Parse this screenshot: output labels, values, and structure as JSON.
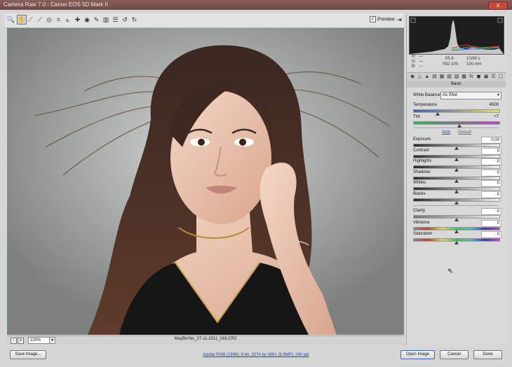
{
  "window": {
    "title": "Camera Raw 7.0  -  Canon EOS 5D Mark II",
    "close_glyph": "x"
  },
  "toolbar": {
    "tools": [
      {
        "name": "zoom-tool-icon",
        "glyph": "🔍"
      },
      {
        "name": "hand-tool-icon",
        "glyph": "✋"
      },
      {
        "name": "white-balance-tool-icon",
        "glyph": "⟋"
      },
      {
        "name": "color-sampler-tool-icon",
        "glyph": "⟋"
      },
      {
        "name": "targeted-adjustment-tool-icon",
        "glyph": "◎"
      },
      {
        "name": "crop-tool-icon",
        "glyph": "⌗"
      },
      {
        "name": "straighten-tool-icon",
        "glyph": "⟀"
      },
      {
        "name": "spot-removal-tool-icon",
        "glyph": "✚"
      },
      {
        "name": "red-eye-tool-icon",
        "glyph": "◉"
      },
      {
        "name": "adjustment-brush-icon",
        "glyph": "✎"
      },
      {
        "name": "graduated-filter-icon",
        "glyph": "▥"
      },
      {
        "name": "preferences-icon",
        "glyph": "☰"
      },
      {
        "name": "rotate-ccw-icon",
        "glyph": "↺"
      },
      {
        "name": "rotate-cw-icon",
        "glyph": "↻"
      }
    ],
    "preview_label": "Preview",
    "preview_checked": "✓",
    "fullscreen_glyph": "⇥"
  },
  "readout": {
    "r_label": "R:",
    "r_val": "---",
    "g_label": "G:",
    "g_val": "---",
    "b_label": "B:",
    "b_val": "---",
    "aperture": "f/5,6",
    "shutter": "1/160 s",
    "iso": "ISO 100",
    "focal": "100 mm"
  },
  "panel": {
    "header": "Basic",
    "tab_glyphs": [
      "◉",
      "△",
      "▲",
      "▤",
      "▦",
      "▧",
      "▨",
      "▩",
      "fx",
      "◼",
      "▣",
      "☰",
      "▢"
    ],
    "white_balance_label": "White Balance:",
    "white_balance_value": "As Shot",
    "temperature": {
      "label": "Temperature",
      "value": "4500",
      "level": 0.28
    },
    "tint": {
      "label": "Tint",
      "value": "+7",
      "level": 0.53
    },
    "auto_label": "Auto",
    "default_label": "Default",
    "tone": [
      {
        "label": "Exposure",
        "value": "0,00",
        "level": 0.5
      },
      {
        "label": "Contrast",
        "value": "0",
        "level": 0.5
      },
      {
        "label": "Highlights",
        "value": "0",
        "level": 0.5
      },
      {
        "label": "Shadows",
        "value": "0",
        "level": 0.5
      },
      {
        "label": "Whites",
        "value": "0",
        "level": 0.5
      },
      {
        "label": "Blacks",
        "value": "0",
        "level": 0.5
      }
    ],
    "presence": [
      {
        "label": "Clarity",
        "value": "0",
        "level": 0.5
      },
      {
        "label": "Vibrance",
        "value": "0",
        "level": 0.5
      },
      {
        "label": "Saturation",
        "value": "0",
        "level": 0.5
      }
    ]
  },
  "status": {
    "zoom_minus": "-",
    "zoom_plus": "+",
    "zoom_value": "100%",
    "zoom_dropdown": "▾",
    "filename": "MayBeYes_27-11-2011_016.CR2"
  },
  "footer": {
    "save_label": "Save Image...",
    "workflow_link": "Adobe RGB (1998); 8 bit; 2574 by 3861 (9,9MP); 240 ppi",
    "open_label": "Open Image",
    "cancel_label": "Cancel",
    "done_label": "Done"
  },
  "colors": {
    "accent": "#3b63c4",
    "title_bar": "#7a5450",
    "backdrop": "#b8bcbb"
  }
}
